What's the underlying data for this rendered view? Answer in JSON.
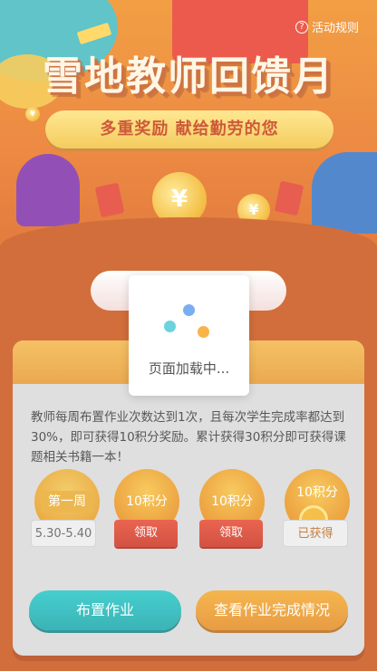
{
  "hero": {
    "rules_link": "活动规则",
    "title": "雪地教师回馈月",
    "subtitle": "多重奖励  献给勤劳的您"
  },
  "card": {
    "description": "教师每周布置作业次数达到1次，且每次学生完成率都达到30%，即可获得10积分奖励。累计获得30积分即可获得课题相关书籍一本！",
    "steps": [
      {
        "badge": "第一周",
        "chip": "5.30-5.40"
      },
      {
        "badge": "10积分",
        "chip": "领取"
      },
      {
        "badge": "10积分",
        "chip": "领取"
      },
      {
        "badge": "10积分",
        "chip": "已获得"
      }
    ],
    "assign_button": "布置作业",
    "check_button": "查看作业完成情况"
  },
  "loading": {
    "text": "页面加载中..."
  },
  "colors": {
    "background": "#c94f10",
    "accent_orange": "#e88d16",
    "teal": "#10a3a6",
    "red": "#c92c1a"
  }
}
